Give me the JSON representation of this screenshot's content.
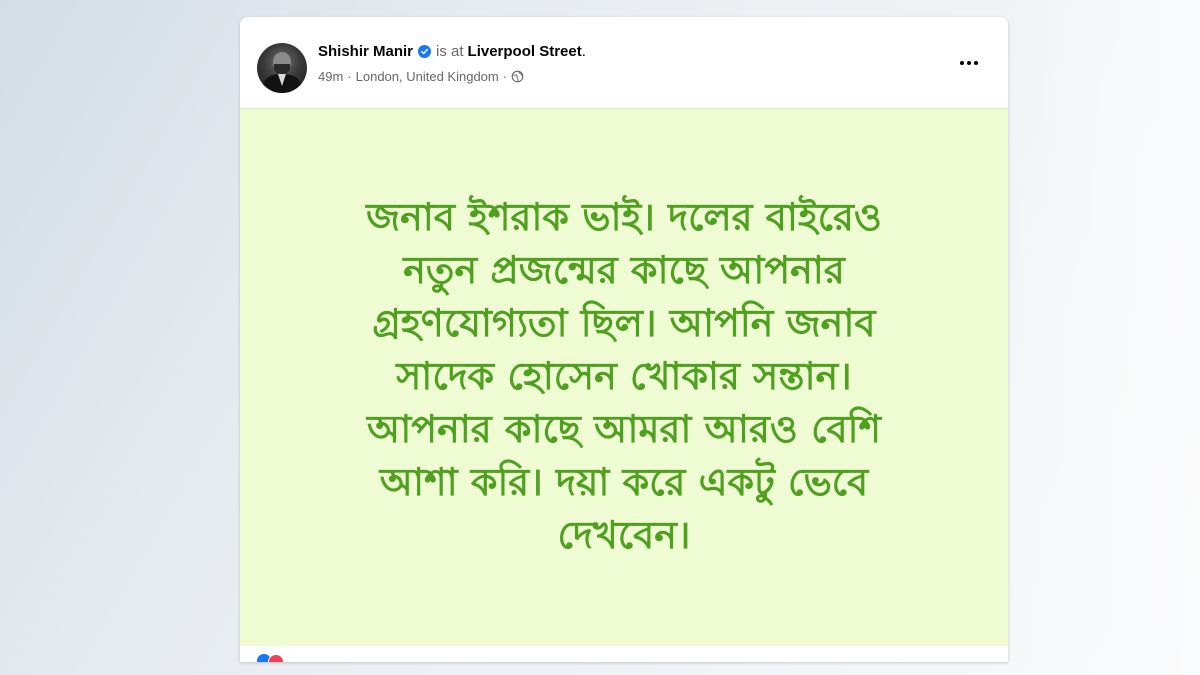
{
  "post": {
    "author": "Shishir Manir",
    "checkin_prefix": "is at",
    "place": "Liverpool Street",
    "place_suffix": ".",
    "time_ago": "49m",
    "location": "London, United Kingdom",
    "separator": "·",
    "visibility_icon": "globe-icon",
    "verified_icon": "verified-badge-icon",
    "more_icon": "more-options-icon",
    "body_lines": [
      "জনাব ইশরাক ভাই। দলের বাইরেও",
      "নতুন প্রজন্মের কাছে আপনার",
      "গ্রহণযোগ্যতা ছিল। আপনি জনাব",
      "সাদেক হোসেন খোকার সন্তান।",
      "আপনার কাছে আমরা আরও বেশি",
      "আশা করি। দয়া করে একটু ভেবে",
      "দেখবেন।"
    ],
    "footer": {
      "reaction_icons": [
        "like-reaction-icon",
        "love-reaction-icon"
      ],
      "partial_middle_text": "",
      "partial_right_text": ""
    }
  },
  "colors": {
    "post_background": "#effbd3",
    "post_text": "#4fa01e",
    "verified": "#1877f2",
    "meta_text": "#65676b"
  }
}
